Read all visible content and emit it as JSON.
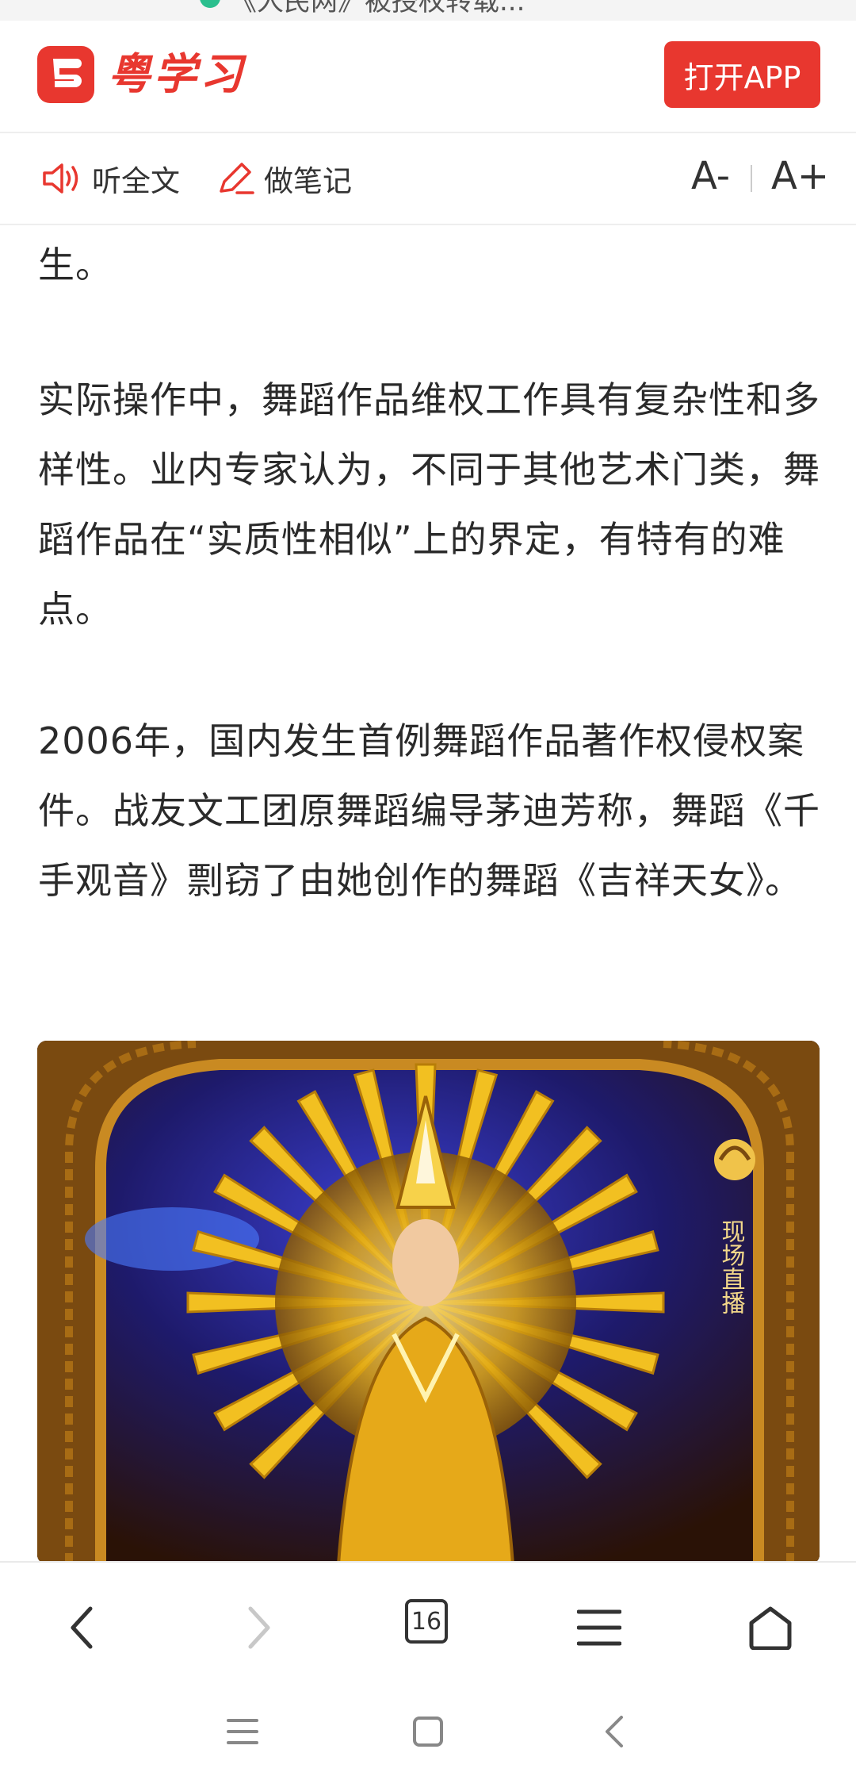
{
  "status": {
    "url_fragment": "《人民网》被授权转载..."
  },
  "header": {
    "logo_text": "粤学习",
    "open_app_label": "打开APP"
  },
  "toolbar": {
    "listen_label": "听全文",
    "note_label": "做笔记",
    "font_decrease": "A-",
    "font_increase": "A+"
  },
  "article": {
    "paragraphs": [
      "生。",
      "实际操作中，舞蹈作品维权工作具有复杂性和多样性。业内专家认为，不同于其他艺术门类，舞蹈作品在“实质性相似”上的界定，有特有的难点。",
      "2006年，国内发生首例舞蹈作品著作权侵权案件。战友文工团原舞蹈编导茅迪芳称，舞蹈《千手观音》剽窃了由她创作的舞蹈《吉祥天女》。"
    ],
    "image_overlay": "现场直播"
  },
  "browser_nav": {
    "tab_count": "16"
  },
  "colors": {
    "brand": "#e8372f",
    "text": "#2a2a2a"
  }
}
